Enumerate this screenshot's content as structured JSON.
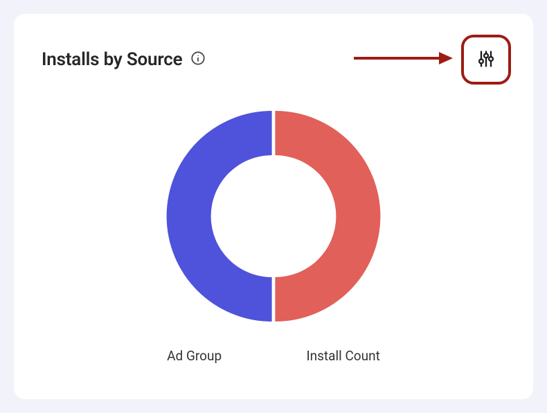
{
  "header": {
    "title": "Installs by Source"
  },
  "legend": {
    "series0": "Ad Group",
    "series1": "Install Count"
  },
  "colors": {
    "series0": "#4f52db",
    "series1": "#e16059",
    "highlight": "#9d1c14"
  },
  "chart_data": {
    "type": "pie",
    "title": "Installs by Source",
    "series": [
      {
        "name": "Ad Group",
        "value": 50
      },
      {
        "name": "Install Count",
        "value": 50
      }
    ]
  }
}
